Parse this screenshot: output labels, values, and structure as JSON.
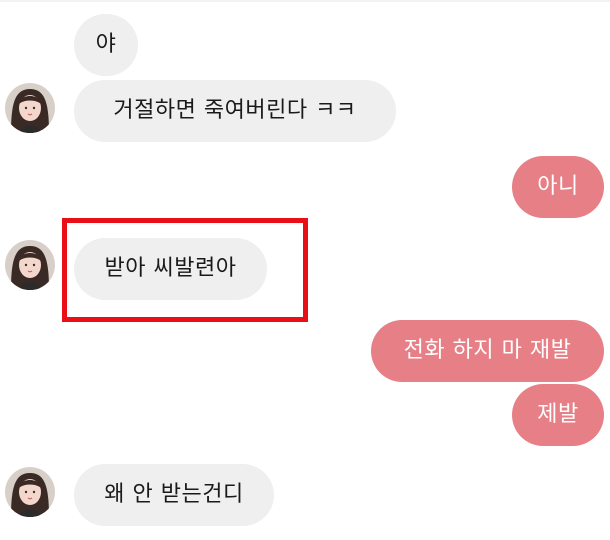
{
  "messages": [
    {
      "id": "m1",
      "side": "incoming",
      "text": "야"
    },
    {
      "id": "m2",
      "side": "incoming",
      "text": "거절하면 죽여버린다 ㅋㅋ"
    },
    {
      "id": "m3",
      "side": "outgoing",
      "text": "아니"
    },
    {
      "id": "m4",
      "side": "incoming",
      "text": "받아 씨발련아"
    },
    {
      "id": "m5",
      "side": "outgoing",
      "text": "전화 하지 마 재발"
    },
    {
      "id": "m6",
      "side": "outgoing",
      "text": "제발"
    },
    {
      "id": "m7",
      "side": "incoming",
      "text": "왜 안 받는건디"
    }
  ],
  "colors": {
    "incoming_bubble": "#efefef",
    "outgoing_bubble": "#e77f86",
    "highlight_box": "#ea0f16"
  }
}
